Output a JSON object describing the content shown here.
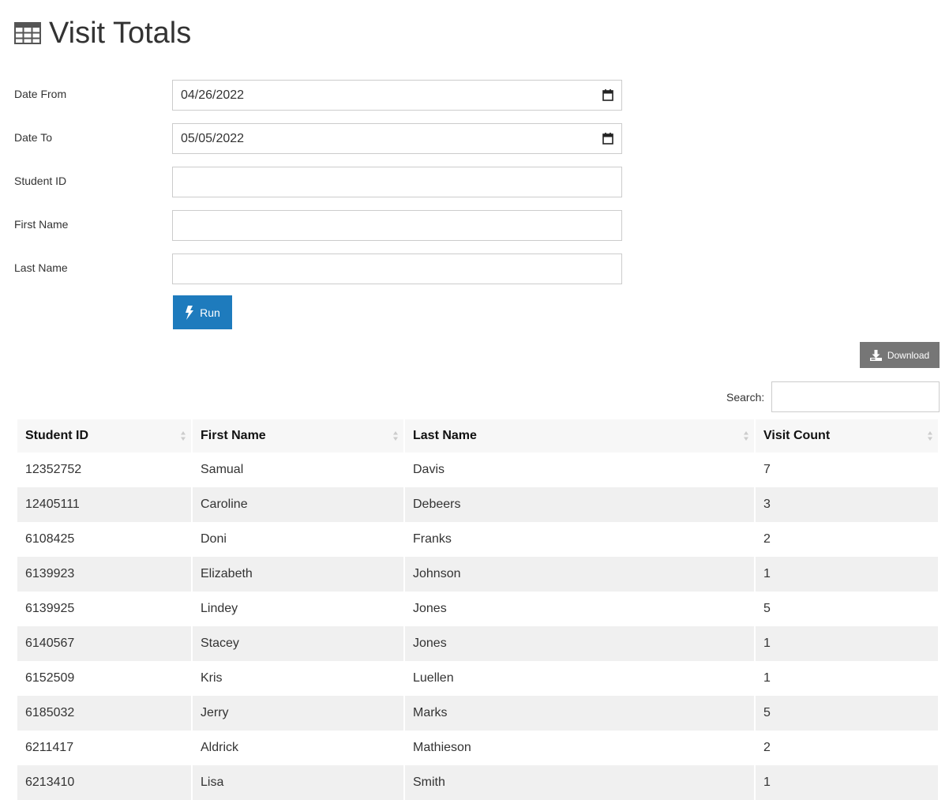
{
  "header": {
    "title": "Visit Totals",
    "icon": "table-icon"
  },
  "form": {
    "date_from": {
      "label": "Date From",
      "value": "04/26/2022"
    },
    "date_to": {
      "label": "Date To",
      "value": "05/05/2022"
    },
    "student_id": {
      "label": "Student ID",
      "value": ""
    },
    "first_name": {
      "label": "First Name",
      "value": ""
    },
    "last_name": {
      "label": "Last Name",
      "value": ""
    },
    "run_label": "Run"
  },
  "toolbar": {
    "download_label": "Download",
    "search_label": "Search:",
    "search_value": ""
  },
  "table": {
    "columns": [
      "Student ID",
      "First Name",
      "Last Name",
      "Visit Count"
    ],
    "rows": [
      [
        "12352752",
        "Samual",
        "Davis",
        "7"
      ],
      [
        "12405111",
        "Caroline",
        "Debeers",
        "3"
      ],
      [
        "6108425",
        "Doni",
        "Franks",
        "2"
      ],
      [
        "6139923",
        "Elizabeth",
        "Johnson",
        "1"
      ],
      [
        "6139925",
        "Lindey",
        "Jones",
        "5"
      ],
      [
        "6140567",
        "Stacey",
        "Jones",
        "1"
      ],
      [
        "6152509",
        "Kris",
        "Luellen",
        "1"
      ],
      [
        "6185032",
        "Jerry",
        "Marks",
        "5"
      ],
      [
        "6211417",
        "Aldrick",
        "Mathieson",
        "2"
      ],
      [
        "6213410",
        "Lisa",
        "Smith",
        "1"
      ]
    ]
  },
  "colors": {
    "run_button": "#1e7bbd",
    "download_button": "#767676",
    "header_bg": "#f7f7f7",
    "stripe_bg": "#f0f0f0"
  }
}
